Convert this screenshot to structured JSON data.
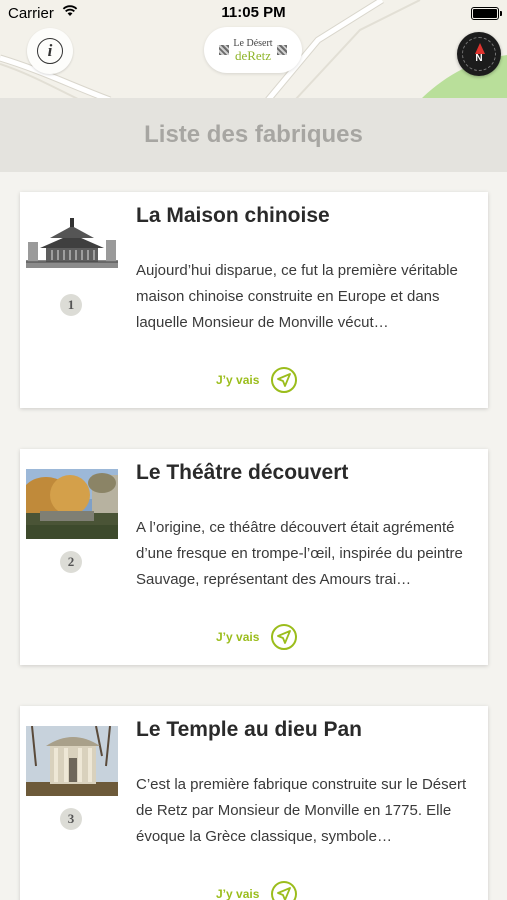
{
  "status_bar": {
    "carrier": "Carrier",
    "time": "11:05 PM",
    "wifi_icon": "wifi-icon",
    "battery_icon": "battery-icon"
  },
  "header": {
    "info_icon": "info-icon",
    "logo": {
      "line1": "Le Désert",
      "line2": "deRetz"
    },
    "compass_icon": "compass-icon",
    "compass_label": "N"
  },
  "page_title": "Liste des fabriques",
  "colors": {
    "accent": "#9bbd1c",
    "title_band": "#e4e3de",
    "title_text": "#a7a6a2",
    "compass_needle": "#e0332e"
  },
  "fabriques": [
    {
      "number": "1",
      "title": "La Maison chinoise",
      "description": "Aujourd’hui disparue, ce fut la première véritable maison chinoise construite en Europe et dans laquelle Monsieur de Monville vécut…",
      "go_label": "J’y vais",
      "thumb_icon": "chinese-house-engraving-image"
    },
    {
      "number": "2",
      "title": "Le Théâtre  découvert",
      "description": "A l’origine, ce théâtre découvert était agrémenté d’une fresque en trompe-l’œil, inspirée du peintre Sauvage, représentant des Amours trai…",
      "go_label": "J’y vais",
      "thumb_icon": "open-theatre-photo"
    },
    {
      "number": "3",
      "title": "Le Temple au dieu Pan",
      "description": "C’est la première fabrique construite sur le Désert de Retz par Monsieur de Monville en 1775. Elle évoque la Grèce classique, symbole…",
      "go_label": "J’y vais",
      "thumb_icon": "temple-pan-photo"
    }
  ]
}
